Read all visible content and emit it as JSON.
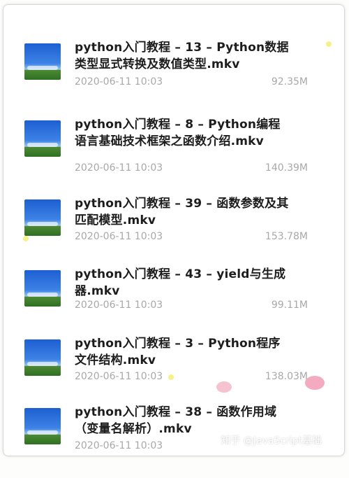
{
  "files": [
    {
      "title": "python入门教程 – 13 – Python数据类型显式转换及数值类型.mkv",
      "date": "2020-06-11 10:03",
      "size": "92.35M"
    },
    {
      "title": "python入门教程 – 8 – Python编程语言基础技术框架之函数介绍.mkv",
      "date": "2020-06-11 10:03",
      "size": "140.39M"
    },
    {
      "title": "python入门教程 – 39 – 函数参数及其匹配模型.mkv",
      "date": "2020-06-11 10:03",
      "size": "153.78M"
    },
    {
      "title": "python入门教程 – 43 – yield与生成器.mkv",
      "date": "2020-06-11 10:03",
      "size": "99.11M"
    },
    {
      "title": "python入门教程 – 3 – Python程序文件结构.mkv",
      "date": "2020-06-11 10:03",
      "size": "138.03M"
    },
    {
      "title": "python入门教程 – 38 – 函数作用域（变量名解析）.mkv",
      "date": "2020-06-11 10:03",
      "size": ""
    }
  ],
  "watermark": "知乎 @JavaScript基础",
  "icons": {
    "thumbnail": "video-thumbnail-icon"
  }
}
